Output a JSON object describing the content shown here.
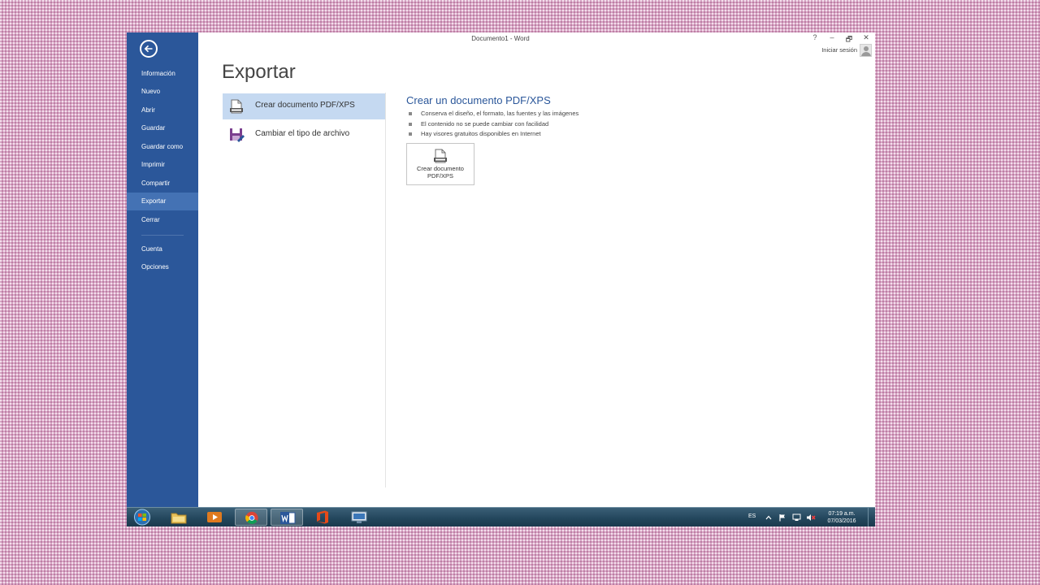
{
  "window": {
    "title": "Documento1 - Word",
    "controls": {
      "help": "?",
      "minimize": "–",
      "restore": "🗗",
      "close": "✕"
    },
    "signin_label": "Iniciar sesión"
  },
  "sidebar": {
    "items": [
      {
        "label": "Información"
      },
      {
        "label": "Nuevo"
      },
      {
        "label": "Abrir"
      },
      {
        "label": "Guardar"
      },
      {
        "label": "Guardar como"
      },
      {
        "label": "Imprimir"
      },
      {
        "label": "Compartir"
      },
      {
        "label": "Exportar"
      },
      {
        "label": "Cerrar"
      },
      {
        "label": "Cuenta"
      },
      {
        "label": "Opciones"
      }
    ],
    "active": "Exportar"
  },
  "main": {
    "title": "Exportar",
    "options": [
      {
        "label": "Crear documento PDF/XPS",
        "icon": "pdf-document-icon"
      },
      {
        "label": "Cambiar el tipo de archivo",
        "icon": "save-as-icon"
      }
    ],
    "detail": {
      "heading": "Crear un documento PDF/XPS",
      "bullets": [
        "Conserva el diseño, el formato, las fuentes y las imágenes",
        "El contenido no se puede cambiar con facilidad",
        "Hay visores gratuitos disponibles en Internet"
      ],
      "button_label": "Crear documento PDF/XPS"
    }
  },
  "taskbar": {
    "apps": [
      "file-explorer-icon",
      "media-player-icon",
      "chrome-icon",
      "word-icon",
      "office-icon",
      "remote-desktop-icon"
    ],
    "tray": {
      "language": "ES",
      "time": "07:19 a.m.",
      "date": "07/03/2016"
    }
  },
  "colors": {
    "accent": "#2b579a",
    "sidebar_active": "#4472b4",
    "selected_option": "#c5d9f1"
  }
}
